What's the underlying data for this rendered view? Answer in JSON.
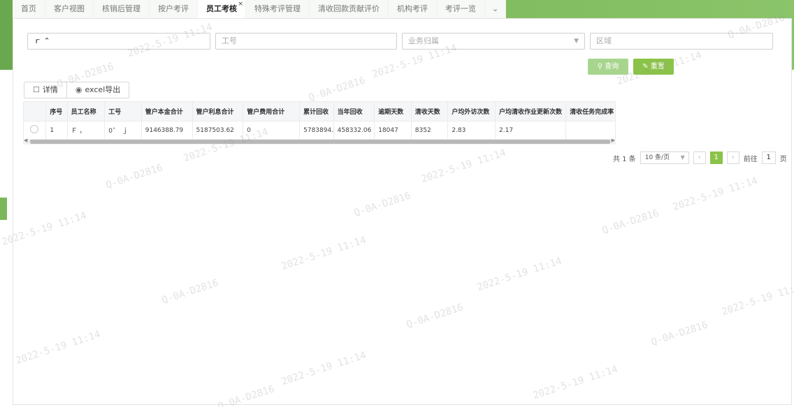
{
  "tabs": [
    {
      "label": "首页"
    },
    {
      "label": "客户视图"
    },
    {
      "label": "核销后管理"
    },
    {
      "label": "按户考评"
    },
    {
      "label": "员工考核",
      "active": true,
      "close": "×"
    },
    {
      "label": "特殊考评管理"
    },
    {
      "label": "清收回款贡献评价"
    },
    {
      "label": "机构考评"
    },
    {
      "label": "考评一览"
    }
  ],
  "tab_more": "⌄",
  "search": {
    "name_value": "ｒ  ⌃",
    "empno_placeholder": "工号",
    "business_placeholder": "业务归属",
    "region_placeholder": "区域"
  },
  "buttons": {
    "query": "查询",
    "reset": "重置",
    "detail": "详情",
    "export": "excel导出"
  },
  "table": {
    "headers": [
      "",
      "序号",
      "员工名称",
      "工号",
      "管户本金合计",
      "管户利息合计",
      "管户费用合计",
      "累计回收",
      "当年回收",
      "逾期天数",
      "清收天数",
      "户均外访次数",
      "户均清收作业更新次数",
      "清收任务完成率"
    ],
    "rows": [
      [
        "",
        "1",
        "Ｆ ，",
        "0ˆ　ｊ",
        "9146388.79",
        "5187503.62",
        "0",
        "5783894.89",
        "458332.06",
        "18047",
        "8352",
        "2.83",
        "2.17",
        ""
      ]
    ]
  },
  "pager": {
    "total": "共 1 条",
    "page_size": "10 条/页",
    "current": "1",
    "goto_label": "前往",
    "goto_value": "1",
    "page_suffix": "页"
  },
  "watermark": {
    "id": "Q-0A-D2816",
    "date": "2022-5-19 11:14"
  },
  "colors": {
    "accent": "#8bc34a",
    "accent_light": "#a8d58e"
  }
}
